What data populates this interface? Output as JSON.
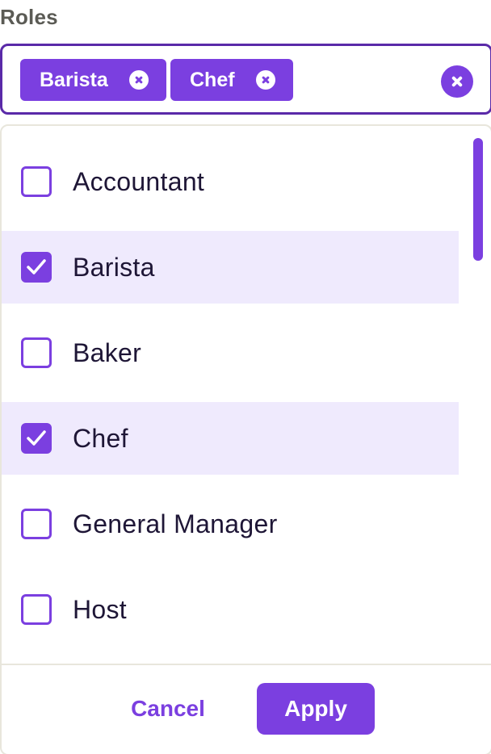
{
  "field": {
    "label": "Roles"
  },
  "selected_chips": [
    {
      "label": "Barista"
    },
    {
      "label": "Chef"
    }
  ],
  "options": [
    {
      "label": "Accountant",
      "checked": false
    },
    {
      "label": "Barista",
      "checked": true
    },
    {
      "label": "Baker",
      "checked": false
    },
    {
      "label": "Chef",
      "checked": true
    },
    {
      "label": "General Manager",
      "checked": false
    },
    {
      "label": "Host",
      "checked": false
    }
  ],
  "footer": {
    "cancel_label": "Cancel",
    "apply_label": "Apply"
  },
  "colors": {
    "accent": "#7b3fe0",
    "border_dark": "#5a2aa8",
    "selected_row_bg": "#efeafd",
    "text": "#1e1636",
    "label_gray": "#5b5b55"
  },
  "icons": {
    "chip_remove": "close-circle-icon",
    "clear_all": "close-circle-icon",
    "checked": "checkmark-icon"
  }
}
